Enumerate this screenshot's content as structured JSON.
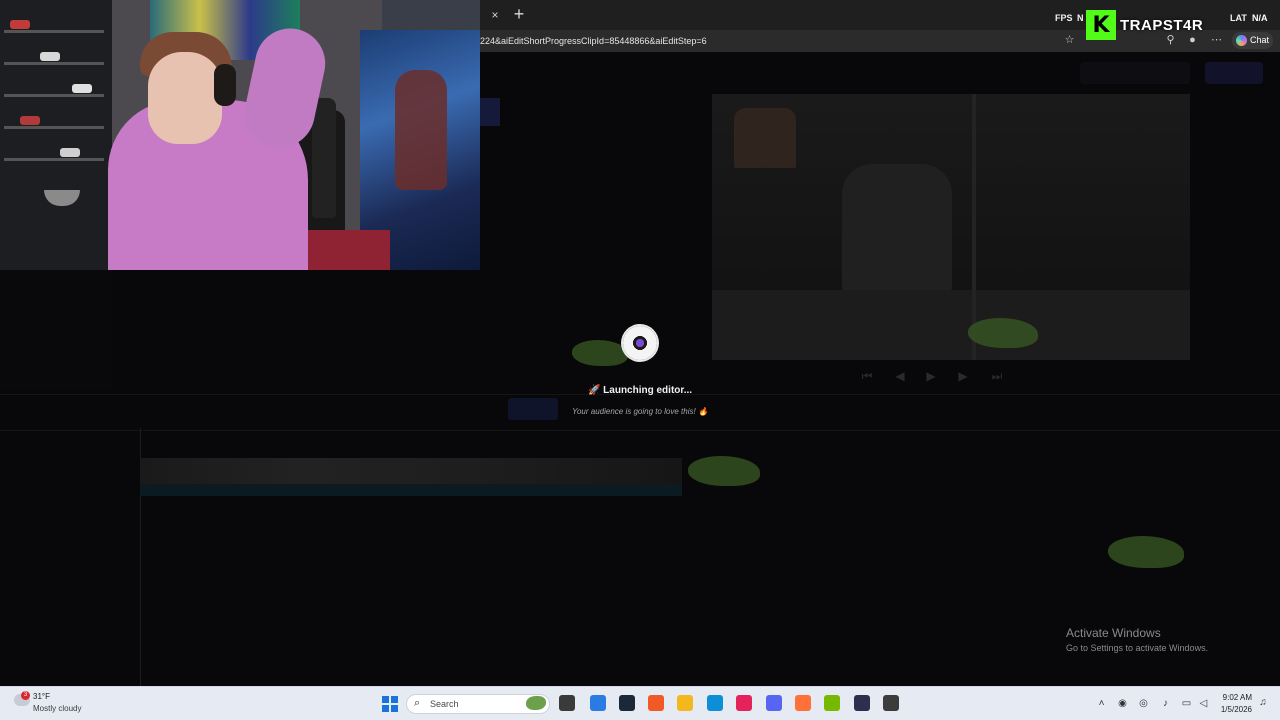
{
  "browser": {
    "tab_close": "×",
    "new_tab": "+",
    "url": "224&aiEditShortProgressClipId=85448866&aiEditStep=6",
    "chat_label": "Chat"
  },
  "overlay": {
    "fps_label": "FPS",
    "fps_value": "N",
    "kick_logo": "K",
    "channel_name": "TRAPST4R",
    "lat_label": "LAT",
    "lat_value": "N/A"
  },
  "loader": {
    "title": "🚀 Launching editor...",
    "subtitle": "Your audience is going to love this! 🔥"
  },
  "watermark": {
    "title": "Activate Windows",
    "subtitle": "Go to Settings to activate Windows."
  },
  "taskbar": {
    "weather_badge": "3",
    "temperature": "31°F",
    "condition": "Mostly cloudy",
    "search_placeholder": "Search",
    "time": "9:02 AM",
    "date": "1/5/2026",
    "apps": [
      "task-view",
      "notepad",
      "steam",
      "brave",
      "file-explorer",
      "edge",
      "tiktok",
      "discord",
      "firefox",
      "nvidia",
      "obs",
      "chrome-like"
    ],
    "app_colors": {
      "task-view": "#3a3a3a",
      "notepad": "#2a7be4",
      "steam": "#1b2838",
      "brave": "#f15a24",
      "file-explorer": "#f2b81e",
      "edge": "#0c8fd6",
      "tiktok": "#e4235c",
      "discord": "#5865f2",
      "firefox": "#ff7139",
      "nvidia": "#76b900",
      "obs": "#302e4d",
      "chrome-like": "#3c3c3c"
    }
  }
}
